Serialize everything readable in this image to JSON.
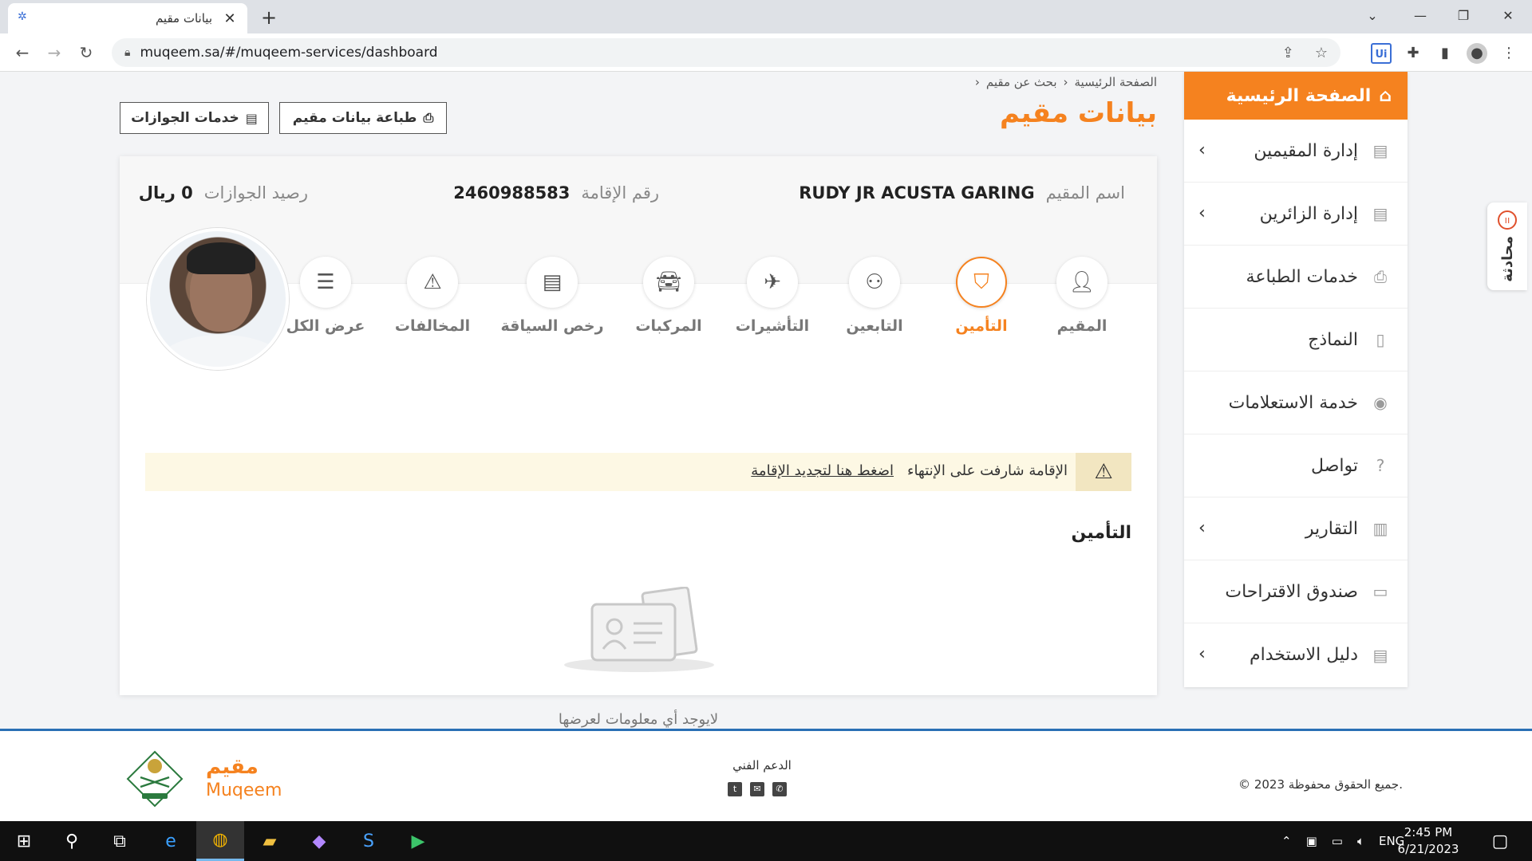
{
  "browser": {
    "tab_title": "بيانات مقيم",
    "url": "muqeem.sa/#/muqeem-services/dashboard"
  },
  "breadcrumb": [
    "الصفحة الرئيسية",
    "بحث عن مقيم"
  ],
  "page_title": "بيانات مقيم",
  "buttons": {
    "print": "طباعة بيانات مقيم",
    "passport_services": "خدمات الجوازات"
  },
  "resident": {
    "name_label": "اسم المقيم",
    "name": "RUDY JR ACUSTA GARING",
    "iqama_label": "رقم الإقامة",
    "iqama": "2460988583",
    "balance_label": "رصيد الجوازات",
    "balance": "0 ريال"
  },
  "tabs": [
    {
      "label": "المقيم",
      "icon": "person-icon",
      "active": false
    },
    {
      "label": "التأمين",
      "icon": "shield-icon",
      "active": true
    },
    {
      "label": "التابعين",
      "icon": "group-icon",
      "active": false
    },
    {
      "label": "التأشيرات",
      "icon": "plane-icon",
      "active": false
    },
    {
      "label": "المركبات",
      "icon": "car-icon",
      "active": false
    },
    {
      "label": "رخص السياقة",
      "icon": "id-card-icon",
      "active": false
    },
    {
      "label": "المخالفات",
      "icon": "warning-icon",
      "active": false
    },
    {
      "label": "عرض الكل",
      "icon": "list-icon",
      "active": false
    }
  ],
  "alert": {
    "text": "الإقامة شارفت على الإنتهاء",
    "link": "اضغط هنا لتجديد الإقامة"
  },
  "section_title": "التأمين",
  "empty_text": "لايوجد أي معلومات لعرضها",
  "sidebar": {
    "home": "الصفحة الرئيسية",
    "items": [
      {
        "label": "إدارة المقيمين",
        "icon": "id-card-icon",
        "chevron": true
      },
      {
        "label": "إدارة الزائرين",
        "icon": "id-card-icon",
        "chevron": true
      },
      {
        "label": "خدمات الطباعة",
        "icon": "printer-icon",
        "chevron": false
      },
      {
        "label": "النماذج",
        "icon": "document-icon",
        "chevron": false
      },
      {
        "label": "خدمة الاستعلامات",
        "icon": "eye-icon",
        "chevron": false
      },
      {
        "label": "تواصل",
        "icon": "help-icon",
        "chevron": false
      },
      {
        "label": "التقارير",
        "icon": "chart-icon",
        "chevron": true
      },
      {
        "label": "صندوق الاقتراحات",
        "icon": "inbox-icon",
        "chevron": false
      },
      {
        "label": "دليل الاستخدام",
        "icon": "book-icon",
        "chevron": true
      }
    ]
  },
  "chat_label": "محادثة",
  "footer": {
    "copyright": "© جميع الحقوق محفوظة 2023.",
    "support": "الدعم الفني",
    "logo_ar": "مقيم",
    "logo_en": "Muqeem"
  },
  "taskbar": {
    "lang": "ENG",
    "time": "2:45 PM",
    "date": "6/21/2023"
  },
  "colors": {
    "accent": "#f5821f",
    "footer_line": "#2a6fb5"
  }
}
